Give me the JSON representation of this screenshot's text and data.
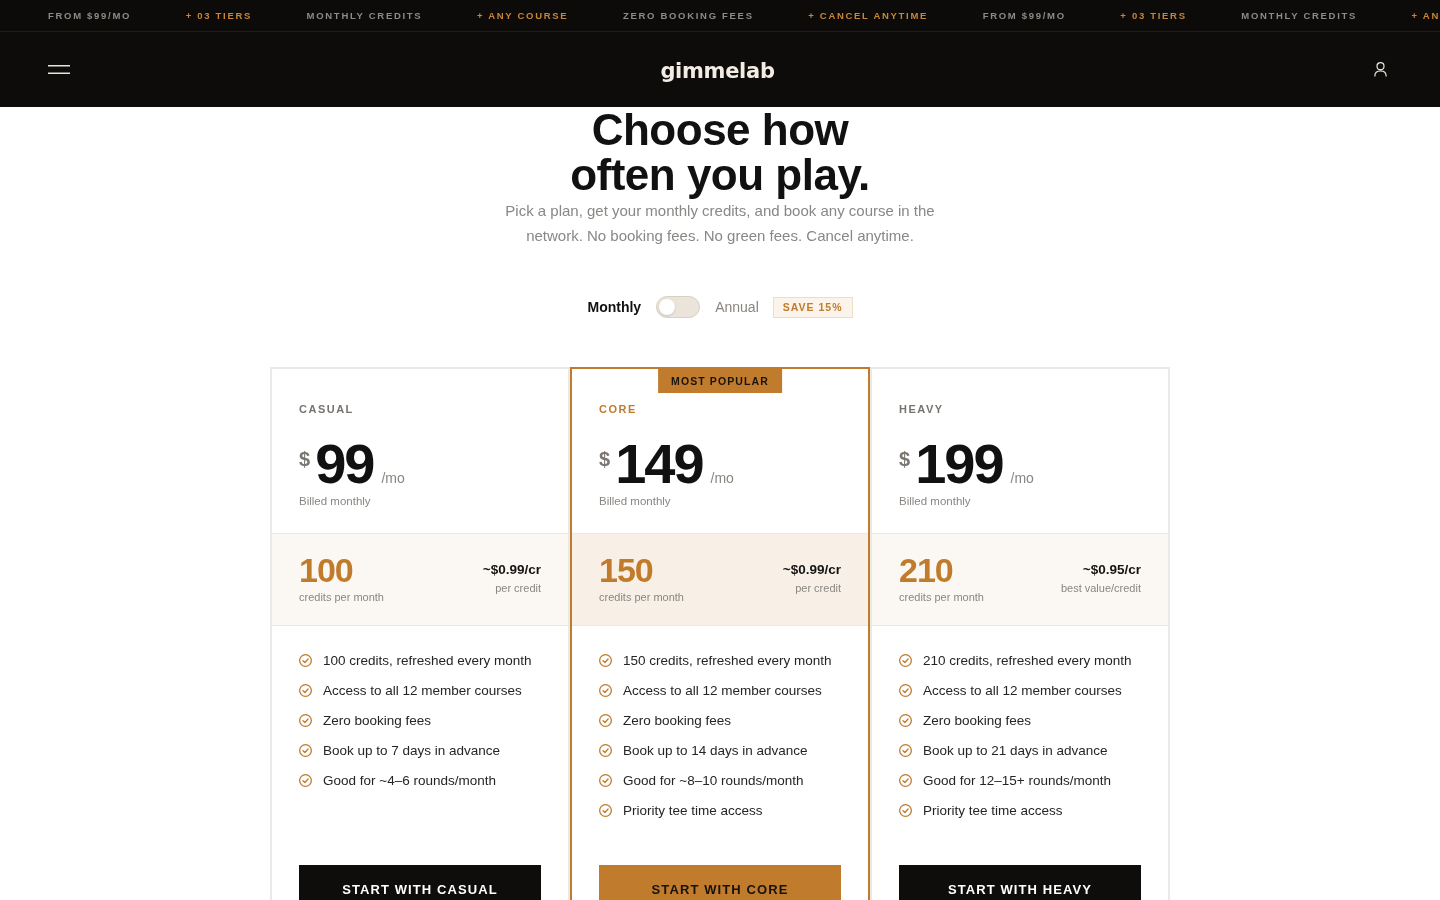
{
  "ticker": [
    {
      "text": "FROM $99/MO",
      "highlight": false
    },
    {
      "text": "+ 03 TIERS",
      "highlight": true
    },
    {
      "text": "MONTHLY CREDITS",
      "highlight": false
    },
    {
      "text": "+ ANY COURSE",
      "highlight": true
    },
    {
      "text": "ZERO BOOKING FEES",
      "highlight": false
    },
    {
      "text": "+ CANCEL ANYTIME",
      "highlight": true
    },
    {
      "text": "FROM $99/MO",
      "highlight": false
    },
    {
      "text": "+ 03 TIERS",
      "highlight": true
    },
    {
      "text": "MONTHLY CREDITS",
      "highlight": false
    },
    {
      "text": "+ AN",
      "highlight": true
    }
  ],
  "header": {
    "logo": "gimmelab"
  },
  "hero": {
    "heading_lines": [
      "Choose how",
      "often you play."
    ],
    "subtitle": "Pick a plan, get your monthly credits, and book any course in the network. No booking fees. No green fees. Cancel anytime."
  },
  "billing": {
    "monthly_label": "Monthly",
    "annual_label": "Annual",
    "annual_on": false,
    "badge": "SAVE 15%"
  },
  "plans": [
    {
      "name": "CASUAL",
      "featured": false,
      "currency": "$",
      "price": "99",
      "period": "/mo",
      "billing_note": "Billed monthly",
      "credits": "100",
      "credits_label": "credits per month",
      "rate": "~$0.99/cr",
      "rate_note": "per credit",
      "features": [
        "100 credits, refreshed every month",
        "Access to all 12 member courses",
        "Zero booking fees",
        "Book up to 7 days in advance",
        "Good for ~4–6 rounds/month"
      ],
      "button": "START WITH CASUAL"
    },
    {
      "name": "CORE",
      "featured": true,
      "ribbon": "MOST POPULAR",
      "currency": "$",
      "price": "149",
      "period": "/mo",
      "billing_note": "Billed monthly",
      "credits": "150",
      "credits_label": "credits per month",
      "rate": "~$0.99/cr",
      "rate_note": "per credit",
      "features": [
        "150 credits, refreshed every month",
        "Access to all 12 member courses",
        "Zero booking fees",
        "Book up to 14 days in advance",
        "Good for ~8–10 rounds/month",
        "Priority tee time access"
      ],
      "button": "START WITH CORE"
    },
    {
      "name": "HEAVY",
      "featured": false,
      "currency": "$",
      "price": "199",
      "period": "/mo",
      "billing_note": "Billed monthly",
      "credits": "210",
      "credits_label": "credits per month",
      "rate": "~$0.95/cr",
      "rate_note": "best value/credit",
      "features": [
        "210 credits, refreshed every month",
        "Access to all 12 member courses",
        "Zero booking fees",
        "Book up to 21 days in advance",
        "Good for 12–15+ rounds/month",
        "Priority tee time access"
      ],
      "button": "START WITH HEAVY"
    }
  ]
}
